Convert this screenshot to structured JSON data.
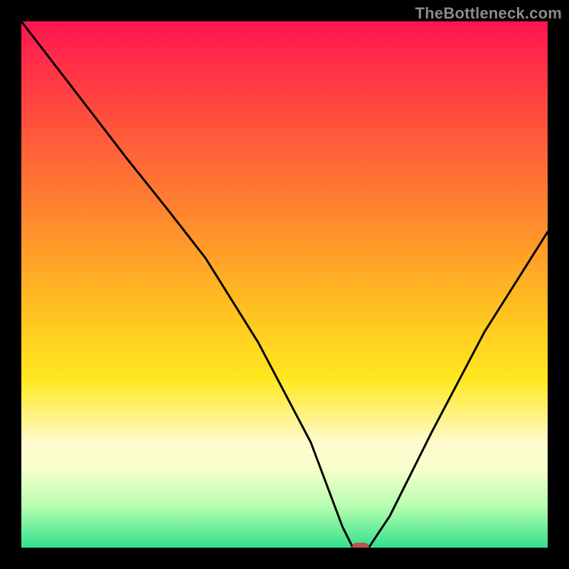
{
  "watermark": "TheBottleneck.com",
  "chart_data": {
    "type": "line",
    "title": "",
    "xlabel": "",
    "ylabel": "",
    "xlim": [
      0,
      100
    ],
    "ylim": [
      0,
      100
    ],
    "x": [
      0,
      10,
      20,
      28,
      35,
      45,
      55,
      61,
      63,
      66,
      70,
      78,
      88,
      100
    ],
    "y": [
      100,
      87,
      74,
      64,
      55,
      39,
      20,
      4,
      0,
      0,
      6,
      22,
      41,
      60
    ],
    "marker": {
      "x": 64.5,
      "y": 0
    },
    "colors": {
      "curve": "#000000",
      "marker": "#c24f4f",
      "gradient_top": "#ff1450",
      "gradient_bottom": "#33e08e",
      "frame": "#000000"
    }
  }
}
